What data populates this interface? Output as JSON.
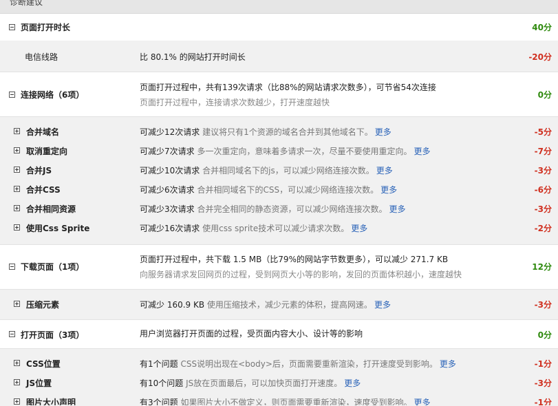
{
  "header": {
    "title": "诊断建议"
  },
  "rows": [
    {
      "name": "页面打开时长",
      "score": "40分",
      "tone": "green"
    },
    {
      "name": "电信线路",
      "text": "比 80.1% 的网站打开时间长",
      "score": "-20分",
      "tone": "red"
    },
    {
      "name": "连接网络（6项）",
      "line1": "页面打开过程中，共有139次请求（比88%的网站请求次数多），可节省54次连接",
      "line2": "页面打开过程中，连接请求次数越少，打开速度越快",
      "score": "0分",
      "tone": "green"
    },
    {
      "name": "合并域名",
      "lead": "可减少12次请求",
      "note": "建议将只有1个资源的域名合并到其他域名下。",
      "more": "更多",
      "score": "-5分",
      "tone": "red"
    },
    {
      "name": "取消重定向",
      "lead": "可减少7次请求",
      "note": "多一次重定向，意味着多请求一次，尽量不要使用重定向。",
      "more": "更多",
      "score": "-7分",
      "tone": "red"
    },
    {
      "name": "合并JS",
      "lead": "可减少10次请求",
      "note": "合并相同域名下的js，可以减少网络连接次数。",
      "more": "更多",
      "score": "-3分",
      "tone": "red"
    },
    {
      "name": "合并CSS",
      "lead": "可减少6次请求",
      "note": "合并相同域名下的CSS，可以减少网络连接次数。",
      "more": "更多",
      "score": "-6分",
      "tone": "red"
    },
    {
      "name": "合并相同资源",
      "lead": "可减少3次请求",
      "note": "合并完全相同的静态资源，可以减少网络连接次数。",
      "more": "更多",
      "score": "-3分",
      "tone": "red"
    },
    {
      "name": "使用Css Sprite",
      "lead": "可减少16次请求",
      "note": "使用css sprite技术可以减少请求次数。",
      "more": "更多",
      "score": "-2分",
      "tone": "red"
    },
    {
      "name": "下载页面（1项）",
      "line1": "页面打开过程中，共下载 1.5 MB（比79%的网站字节数更多），可以减少 271.7 KB",
      "line2": "向服务器请求发回网页的过程，受到网页大小等的影响，发回的页面体积越小，速度越快",
      "score": "12分",
      "tone": "green"
    },
    {
      "name": "压缩元素",
      "lead": "可减少 160.9 KB",
      "note": "使用压缩技术，减少元素的体积，提高网速。",
      "more": "更多",
      "score": "-3分",
      "tone": "red"
    },
    {
      "name": "打开页面（3项）",
      "line1": "用户浏览器打开页面的过程，受页面内容大小、设计等的影响",
      "score": "0分",
      "tone": "green"
    },
    {
      "name": "CSS位置",
      "lead": "有1个问题",
      "note": "CSS说明出现在<body>后，页面需要重新渲染，打开速度受到影响。",
      "more": "更多",
      "score": "-1分",
      "tone": "red"
    },
    {
      "name": "JS位置",
      "lead": "有10个问题",
      "note": "JS放在页面最后，可以加快页面打开速度。",
      "more": "更多",
      "score": "-3分",
      "tone": "red"
    },
    {
      "name": "图片大小声明",
      "lead": "有3个问题",
      "note": "如果图片大小不做定义，则页面需要重新渲染，速度受到影响。",
      "more": "更多",
      "score": "-1分",
      "tone": "red"
    }
  ]
}
